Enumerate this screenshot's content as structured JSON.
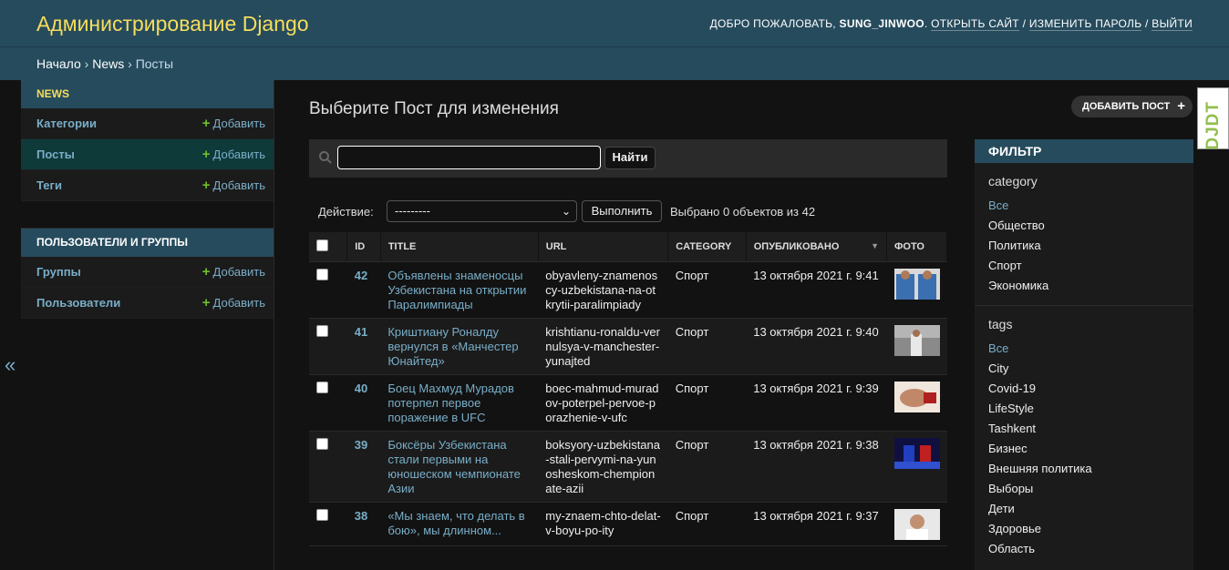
{
  "header": {
    "branding": "Администрирование Django",
    "welcome": "Добро пожаловать,",
    "username": "sung_jinwoo",
    "links": [
      "Открыть сайт",
      "Изменить пароль",
      "Выйти"
    ]
  },
  "breadcrumbs": [
    "Начало",
    "News",
    "Посты"
  ],
  "sidebar": {
    "toggle_icon": "«",
    "apps": [
      {
        "caption": "News",
        "models": [
          {
            "name": "Категории",
            "add": "Добавить"
          },
          {
            "name": "Посты",
            "add": "Добавить"
          },
          {
            "name": "Теги",
            "add": "Добавить"
          }
        ]
      },
      {
        "caption": "Пользователи и группы",
        "models": [
          {
            "name": "Группы",
            "add": "Добавить"
          },
          {
            "name": "Пользователи",
            "add": "Добавить"
          }
        ]
      }
    ]
  },
  "content": {
    "title": "Выберите Пост для изменения",
    "add_button": "Добавить Пост",
    "search": {
      "value": "",
      "button": "Найти"
    },
    "actions": {
      "label": "Действие:",
      "selected": "---------",
      "go": "Выполнить",
      "counter": "Выбрано 0 объектов из 42"
    },
    "columns": [
      "ID",
      "Title",
      "URL",
      "Category",
      "Опубликовано",
      "Фото"
    ],
    "rows": [
      {
        "id": "42",
        "title": "Объявлены знаменосцы Узбекистана на открытии Паралимпиады",
        "url": "obyavleny-znamenoscy-uzbekistana-na-otkrytii-paralimpiady",
        "category": "Спорт",
        "published": "13 октября 2021 г. 9:41"
      },
      {
        "id": "41",
        "title": "Криштиану Роналду вернулся в «Манчестер Юнайтед»",
        "url": "krishtianu-ronaldu-vernulsya-v-manchester-yunajted",
        "category": "Спорт",
        "published": "13 октября 2021 г. 9:40"
      },
      {
        "id": "40",
        "title": "Боец Махмуд Мурадов потерпел первое поражение в UFC",
        "url": "boec-mahmud-muradov-poterpel-pervoe-porazhenie-v-ufc",
        "category": "Спорт",
        "published": "13 октября 2021 г. 9:39"
      },
      {
        "id": "39",
        "title": "Боксёры Узбекистана стали первыми на юношеском чемпионате Азии",
        "url": "boksyory-uzbekistana-stali-pervymi-na-yunosheskom-chempionate-azii",
        "category": "Спорт",
        "published": "13 октября 2021 г. 9:38"
      },
      {
        "id": "38",
        "title": "«Мы знаем, что делать в бою», мы длинном...",
        "url": "my-znaem-chto-delat-v-boyu-po-ity",
        "category": "Спорт",
        "published": "13 октября 2021 г. 9:37"
      }
    ]
  },
  "filter": {
    "title": "Фильтр",
    "sections": [
      {
        "heading": "category",
        "options": [
          "Все",
          "Общество",
          "Политика",
          "Спорт",
          "Экономика"
        ]
      },
      {
        "heading": "tags",
        "options": [
          "Все",
          "City",
          "Covid-19",
          "LifeStyle",
          "Tashkent",
          "Бизнес",
          "Внешняя политика",
          "Выборы",
          "Дети",
          "Здоровье",
          "Область"
        ]
      }
    ]
  },
  "djdt": "DJDT"
}
